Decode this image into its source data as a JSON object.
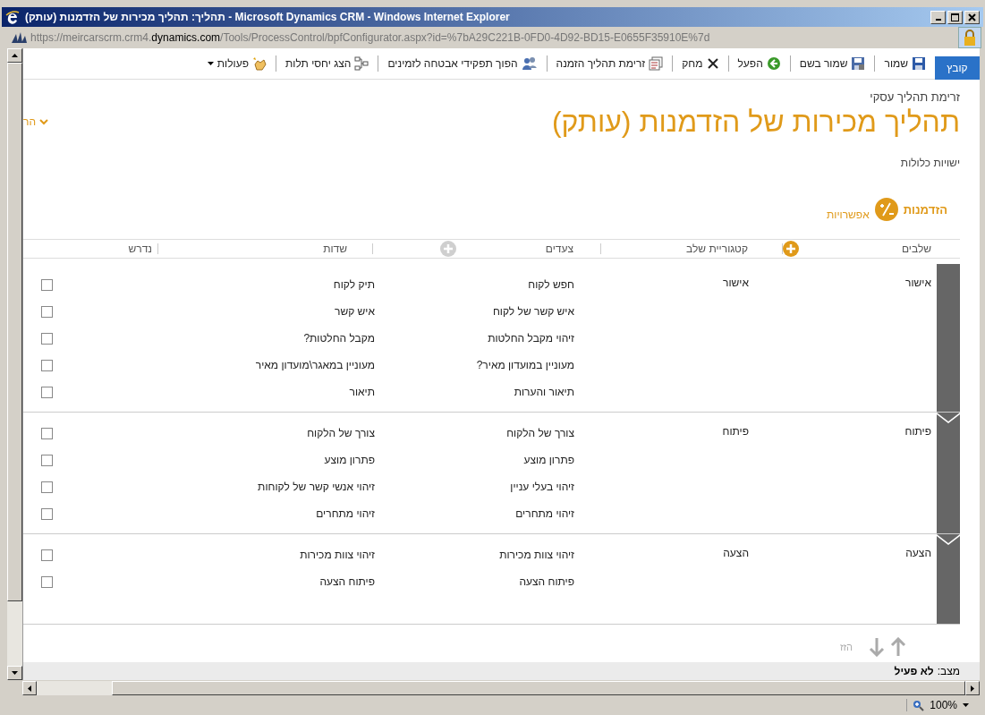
{
  "window": {
    "title": "תהליך: תהליך מכירות של הזדמנות (עותק) - Microsoft Dynamics CRM - Windows Internet Explorer"
  },
  "address_bar": {
    "url_start": "https://meircarscrm.crm4.",
    "url_domain": "dynamics.com",
    "url_path": "/Tools/ProcessControl/bpfConfigurator.aspx?id=%7bA29C221B-0FD0-4D92-BD15-E0655F35910E%7d"
  },
  "toolbar": {
    "file_tab": "קובץ",
    "buttons": [
      {
        "label": "שמור",
        "kind": "save"
      },
      {
        "label": "שמור בשם",
        "kind": "save_as"
      },
      {
        "label": "הפעל",
        "kind": "activate"
      },
      {
        "label": "מחק",
        "kind": "delete"
      },
      {
        "label": "זרימת תהליך הזמנה",
        "kind": "flow"
      },
      {
        "label": "הפוך תפקידי אבטחה לזמינים",
        "kind": "security"
      },
      {
        "label": "הצג יחסי תלות",
        "kind": "dependencies"
      },
      {
        "label": "פעולות",
        "kind": "actions"
      }
    ]
  },
  "header": {
    "breadcrumb": "זרימת תהליך עסקי",
    "title": "תהליך מכירות של הזדמנות (עותק)",
    "side_link": "הר",
    "entities_label": "ישויות כלולות",
    "entity": "הזדמנות",
    "options_link": "אפשרויות"
  },
  "table": {
    "columns": [
      "שלבים",
      "קטגוריית שלב",
      "צעדים",
      "שדות",
      "נדרש"
    ],
    "stages": [
      {
        "name": "אישור",
        "category": "אישור",
        "steps": [
          {
            "step": "חפש לקוח",
            "field": "תיק לקוח",
            "required": false
          },
          {
            "step": "איש קשר של לקוח",
            "field": "איש קשר",
            "required": false
          },
          {
            "step": "זיהוי מקבל החלטות",
            "field": "מקבל החלטות?",
            "required": false
          },
          {
            "step": "מעוניין במועדון מאיר?",
            "field": "מעוניין במאגר\\מועדון מאיר",
            "required": false
          },
          {
            "step": "תיאור והערות",
            "field": "תיאור",
            "required": false
          }
        ]
      },
      {
        "name": "פיתוח",
        "category": "פיתוח",
        "steps": [
          {
            "step": "צורך של הלקוח",
            "field": "צורך של הלקוח",
            "required": false
          },
          {
            "step": "פתרון מוצע",
            "field": "פתרון מוצע",
            "required": false
          },
          {
            "step": "זיהוי בעלי עניין",
            "field": "זיהוי אנשי קשר של לקוחות",
            "required": false
          },
          {
            "step": "זיהוי מתחרים",
            "field": "זיהוי מתחרים",
            "required": false
          }
        ]
      },
      {
        "name": "הצעה",
        "category": "הצעה",
        "steps": [
          {
            "step": "זיהוי צוות מכירות",
            "field": "זיהוי צוות מכירות",
            "required": false
          },
          {
            "step": "פיתוח הצעה",
            "field": "פיתוח הצעה",
            "required": false
          }
        ]
      }
    ]
  },
  "move": {
    "label": "הזז",
    "disabled": true
  },
  "status": {
    "label": "מצב:",
    "value": "לא פעיל"
  },
  "status_bar": {
    "zoom": "100%"
  }
}
